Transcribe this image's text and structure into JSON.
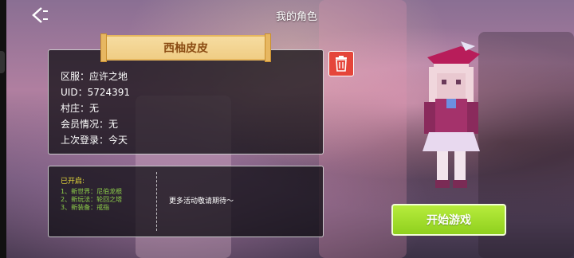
{
  "header": {
    "title": "我的角色",
    "back_icon": "chevron-left-icon"
  },
  "profile": {
    "name": "西柚皮皮",
    "lines": [
      {
        "label": "区服：",
        "value": "应许之地"
      },
      {
        "label": "UID：",
        "value": "5724391"
      },
      {
        "label": "村庄：",
        "value": "无"
      },
      {
        "label": "会员情况：",
        "value": "无"
      },
      {
        "label": "上次登录：",
        "value": "今天"
      }
    ],
    "delete_icon": "trash-icon"
  },
  "unlocks": {
    "title": "已开启:",
    "items": [
      "1、新世界：尼伯龙根",
      "2、新玩法：轮回之塔",
      "3、新装备：戒指"
    ],
    "upcoming": "更多活动敬请期待～"
  },
  "actions": {
    "start_label": "开始游戏"
  },
  "colors": {
    "delete_bg": "#e5453a",
    "start_bg": "#9ad626",
    "banner_bg": "#f3d493",
    "unlock_title": "#e9dd3a",
    "unlock_items": "#8fd14a"
  }
}
